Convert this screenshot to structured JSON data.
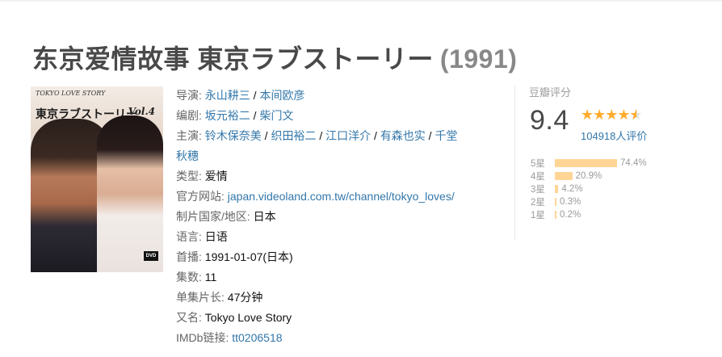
{
  "title": {
    "main": "东京爱情故事 東京ラブストーリー",
    "year": "(1991)"
  },
  "poster": {
    "brand": "TOKYO LOVE STORY",
    "title": "東京ラブストーリー",
    "vol": "Vol.4",
    "dvd": "DVD"
  },
  "info": {
    "director": {
      "label": "导演: ",
      "names": [
        "永山耕三",
        "本间欧彦"
      ]
    },
    "writer": {
      "label": "编剧: ",
      "names": [
        "坂元裕二",
        "柴门文"
      ]
    },
    "cast": {
      "label": "主演: ",
      "names": [
        "铃木保奈美",
        "织田裕二",
        "江口洋介",
        "有森也实",
        "千堂"
      ],
      "names_cont": "秋穗"
    },
    "genre": {
      "label": "类型: ",
      "value": "爱情"
    },
    "website": {
      "label": "官方网站: ",
      "value": "japan.videoland.com.tw/channel/tokyo_loves/"
    },
    "country": {
      "label": "制片国家/地区: ",
      "value": "日本"
    },
    "language": {
      "label": "语言: ",
      "value": "日语"
    },
    "premiere": {
      "label": "首播: ",
      "value": "1991-01-07(日本)"
    },
    "episodes": {
      "label": "集数: ",
      "value": "11"
    },
    "runtime": {
      "label": "单集片长: ",
      "value": "47分钟"
    },
    "aka": {
      "label": "又名: ",
      "value": "Tokyo Love Story"
    },
    "imdb": {
      "label": "IMDb链接: ",
      "value": "tt0206518"
    },
    "separator": " / "
  },
  "rating": {
    "label": "豆瓣评分",
    "score": "9.4",
    "stars": "★★★★",
    "half_star": "★",
    "count": "104918人评价",
    "breakdown": [
      {
        "star": "5星",
        "pct": "74.4%",
        "value": 74.4
      },
      {
        "star": "4星",
        "pct": "20.9%",
        "value": 20.9
      },
      {
        "star": "3星",
        "pct": "4.2%",
        "value": 4.2
      },
      {
        "star": "2星",
        "pct": "0.3%",
        "value": 0.3
      },
      {
        "star": "1星",
        "pct": "0.2%",
        "value": 0.2
      }
    ]
  },
  "colors": {
    "link": "#3377aa",
    "star": "#ffac2d",
    "bar": "#ffd596"
  }
}
